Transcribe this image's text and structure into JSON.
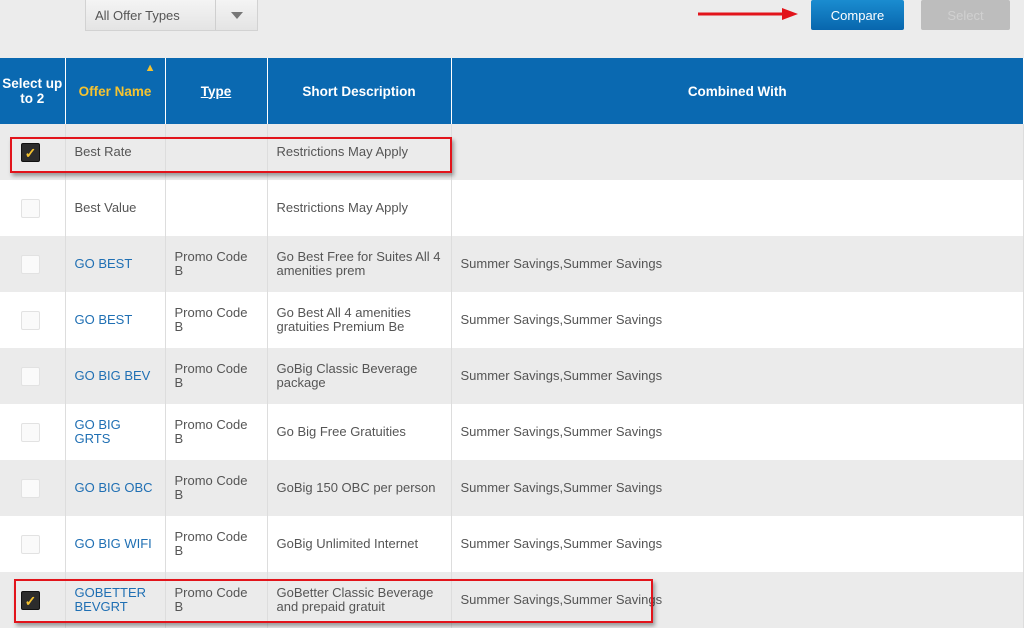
{
  "filter": {
    "selected": "All Offer Types"
  },
  "buttons": {
    "compare": "Compare",
    "select": "Select"
  },
  "colors": {
    "header": "#0a69b1",
    "accent": "#f5c330",
    "highlight": "#e2141b"
  },
  "table": {
    "headers": [
      "Select up to 2",
      "Offer Name",
      "Type",
      "Short Description",
      "Combined With"
    ],
    "sorted_column": "Offer Name",
    "rows": [
      {
        "checked": true,
        "name": "Best Rate",
        "link": false,
        "type": "",
        "desc": "Restrictions May Apply",
        "combined": ""
      },
      {
        "checked": false,
        "name": "Best Value",
        "link": false,
        "type": "",
        "desc": "Restrictions May Apply",
        "combined": ""
      },
      {
        "checked": false,
        "name": "GO BEST",
        "link": true,
        "type": "Promo Code B",
        "desc": "Go Best Free for Suites All 4 amenities prem",
        "combined": "Summer Savings,Summer Savings"
      },
      {
        "checked": false,
        "name": "GO BEST",
        "link": true,
        "type": "Promo Code B",
        "desc": "Go Best All 4 amenities gratuities Premium Be",
        "combined": "Summer Savings,Summer Savings"
      },
      {
        "checked": false,
        "name": "GO BIG BEV",
        "link": true,
        "type": "Promo Code B",
        "desc": "GoBig Classic Beverage package",
        "combined": "Summer Savings,Summer Savings"
      },
      {
        "checked": false,
        "name": "GO BIG GRTS",
        "link": true,
        "type": "Promo Code B",
        "desc": "Go Big Free Gratuities",
        "combined": "Summer Savings,Summer Savings"
      },
      {
        "checked": false,
        "name": "GO BIG OBC",
        "link": true,
        "type": "Promo Code B",
        "desc": "GoBig 150 OBC per person",
        "combined": "Summer Savings,Summer Savings"
      },
      {
        "checked": false,
        "name": "GO BIG WIFI",
        "link": true,
        "type": "Promo Code B",
        "desc": "GoBig Unlimited Internet",
        "combined": "Summer Savings,Summer Savings"
      },
      {
        "checked": true,
        "name": "GOBETTER BEVGRT",
        "link": true,
        "type": "Promo Code B",
        "desc": "GoBetter Classic Beverage and prepaid gratuit",
        "combined": "Summer Savings,Summer Savings"
      }
    ]
  }
}
